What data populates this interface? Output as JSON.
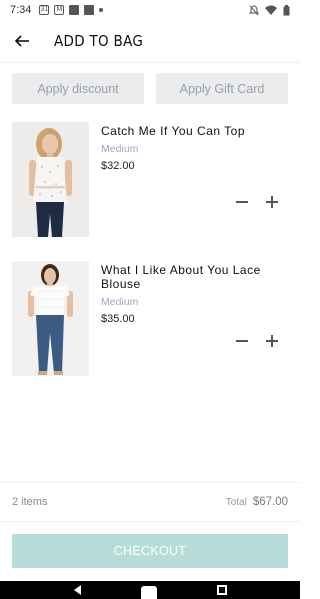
{
  "status_bar": {
    "time": "7:34",
    "calendar_day": "31"
  },
  "header": {
    "title": "ADD TO BAG"
  },
  "actions": {
    "apply_discount": "Apply discount",
    "apply_gift_card": "Apply Gift Card"
  },
  "items": [
    {
      "name": "Catch Me If You Can Top",
      "variant": "Medium",
      "price": "$32.00"
    },
    {
      "name": "What I Like About You Lace Blouse",
      "variant": "Medium",
      "price": "$35.00"
    }
  ],
  "summary": {
    "items_count": "2 items",
    "total_label": "Total",
    "total_value": "$67.00"
  },
  "checkout": {
    "label": "CHECKOUT"
  },
  "colors": {
    "checkout_bg": "#b8ddd9",
    "variant_text": "#a7a2c4",
    "pill_bg": "#ebeced"
  }
}
